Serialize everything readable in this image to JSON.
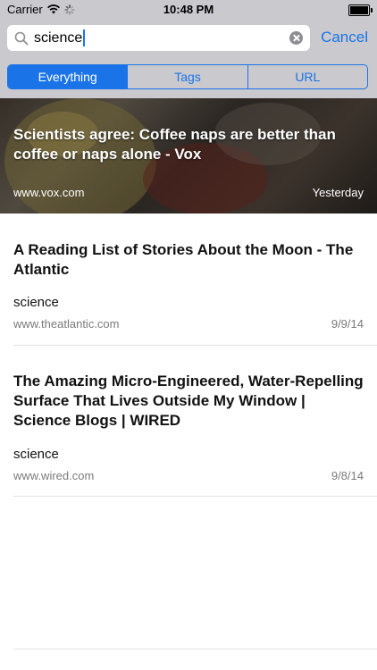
{
  "status_bar": {
    "carrier": "Carrier",
    "time": "10:48 PM"
  },
  "search": {
    "value": "science",
    "cancel_label": "Cancel"
  },
  "segments": [
    {
      "label": "Everything",
      "active": true
    },
    {
      "label": "Tags",
      "active": false
    },
    {
      "label": "URL",
      "active": false
    }
  ],
  "featured": {
    "title": "Scientists agree: Coffee naps are better than coffee or naps alone - Vox",
    "domain": "www.vox.com",
    "date": "Yesterday"
  },
  "results": [
    {
      "title": "A Reading List of Stories About the Moon - The Atlantic",
      "tag": "science",
      "domain": "www.theatlantic.com",
      "date": "9/9/14"
    },
    {
      "title": "The Amazing Micro-Engineered, Water-Repelling Surface That Lives Outside My Window | Science Blogs | WIRED",
      "tag": "science",
      "domain": "www.wired.com",
      "date": "9/8/14"
    }
  ],
  "colors": {
    "accent": "#1a74e8",
    "header_bg": "#c9c9ce"
  }
}
